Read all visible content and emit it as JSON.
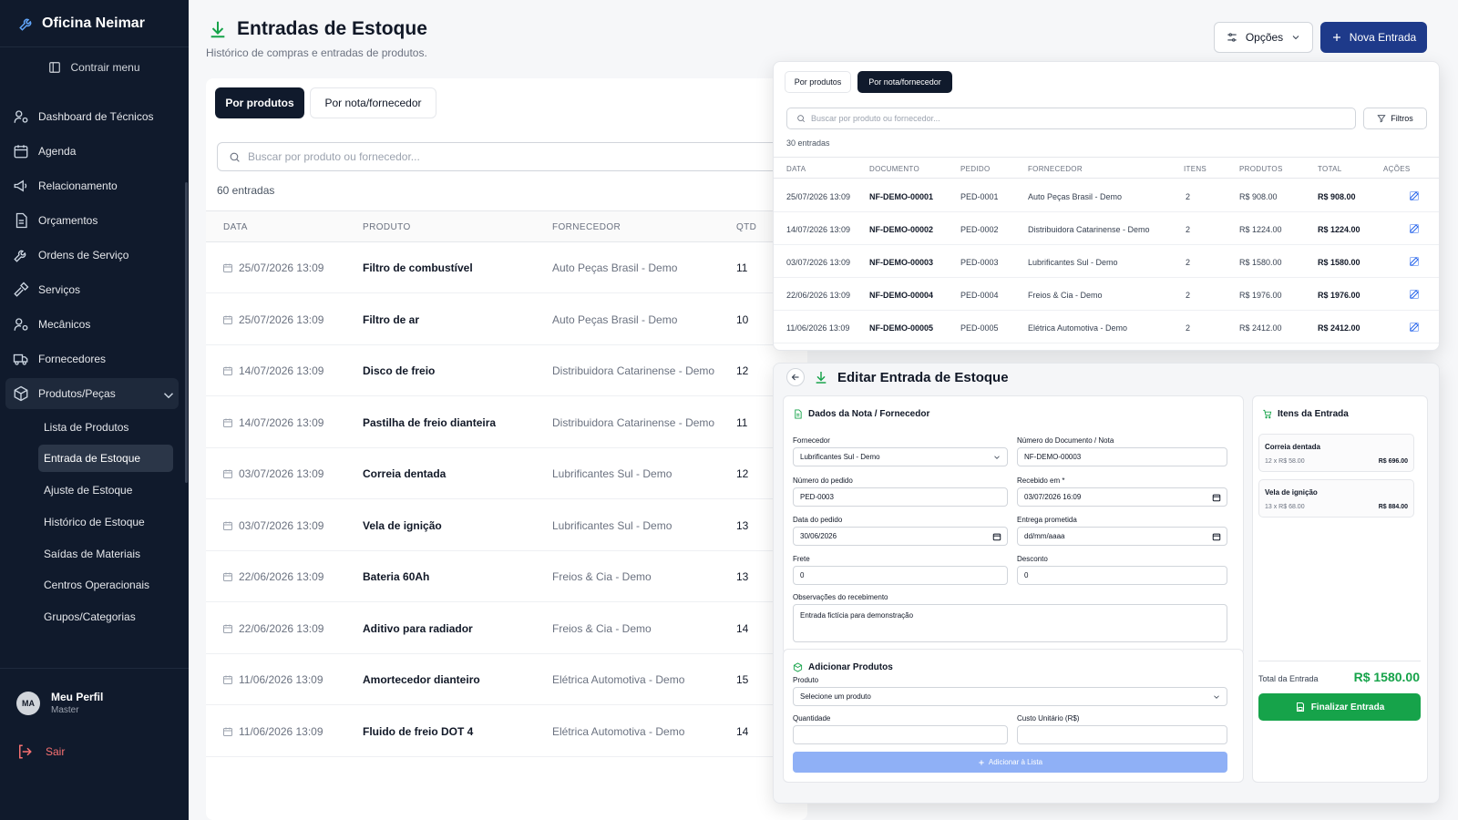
{
  "sidebar": {
    "brand": "Oficina Neimar",
    "collapse_label": "Contrair menu",
    "items": [
      {
        "label": "Dashboard de Técnicos",
        "icon": "users-gear-icon"
      },
      {
        "label": "Agenda",
        "icon": "calendar-icon"
      },
      {
        "label": "Relacionamento",
        "icon": "megaphone-icon"
      },
      {
        "label": "Orçamentos",
        "icon": "document-icon"
      },
      {
        "label": "Ordens de Serviço",
        "icon": "wrench-icon"
      },
      {
        "label": "Serviços",
        "icon": "hammer-icon"
      },
      {
        "label": "Mecânicos",
        "icon": "user-gear-icon"
      },
      {
        "label": "Fornecedores",
        "icon": "truck-icon"
      },
      {
        "label": "Produtos/Peças",
        "icon": "box-icon"
      }
    ],
    "subitems": [
      "Lista de Produtos",
      "Entrada de Estoque",
      "Ajuste de Estoque",
      "Histórico de Estoque",
      "Saídas de Materiais",
      "Centros Operacionais",
      "Grupos/Categorias"
    ],
    "profile": {
      "initials": "MA",
      "name": "Meu Perfil",
      "role": "Master"
    },
    "logout": "Sair"
  },
  "header": {
    "title": "Entradas de Estoque",
    "subtitle": "Histórico de compras e entradas de produtos.",
    "options_label": "Opções",
    "new_label": "Nova Entrada"
  },
  "main": {
    "tabs": [
      "Por produtos",
      "Por nota/fornecedor"
    ],
    "search_placeholder": "Buscar por produto ou fornecedor...",
    "count": "60 entradas",
    "columns": [
      "DATA",
      "PRODUTO",
      "FORNECEDOR",
      "QTD"
    ],
    "rows": [
      {
        "date": "25/07/2026 13:09",
        "product": "Filtro de combustível",
        "supplier": "Auto Peças Brasil - Demo",
        "qty": "11"
      },
      {
        "date": "25/07/2026 13:09",
        "product": "Filtro de ar",
        "supplier": "Auto Peças Brasil - Demo",
        "qty": "10"
      },
      {
        "date": "14/07/2026 13:09",
        "product": "Disco de freio",
        "supplier": "Distribuidora Catarinense - Demo",
        "qty": "12"
      },
      {
        "date": "14/07/2026 13:09",
        "product": "Pastilha de freio dianteira",
        "supplier": "Distribuidora Catarinense - Demo",
        "qty": "11"
      },
      {
        "date": "03/07/2026 13:09",
        "product": "Correia dentada",
        "supplier": "Lubrificantes Sul - Demo",
        "qty": "12"
      },
      {
        "date": "03/07/2026 13:09",
        "product": "Vela de ignição",
        "supplier": "Lubrificantes Sul - Demo",
        "qty": "13"
      },
      {
        "date": "22/06/2026 13:09",
        "product": "Bateria 60Ah",
        "supplier": "Freios & Cia - Demo",
        "qty": "13"
      },
      {
        "date": "22/06/2026 13:09",
        "product": "Aditivo para radiador",
        "supplier": "Freios & Cia - Demo",
        "qty": "14"
      },
      {
        "date": "11/06/2026 13:09",
        "product": "Amortecedor dianteiro",
        "supplier": "Elétrica Automotiva - Demo",
        "qty": "15"
      },
      {
        "date": "11/06/2026 13:09",
        "product": "Fluido de freio DOT 4",
        "supplier": "Elétrica Automotiva - Demo",
        "qty": "14"
      }
    ]
  },
  "notes_view": {
    "tabs": [
      "Por produtos",
      "Por nota/fornecedor"
    ],
    "search_placeholder": "Buscar por produto ou fornecedor...",
    "filter_label": "Filtros",
    "count": "30 entradas",
    "columns": [
      "DATA",
      "DOCUMENTO",
      "PEDIDO",
      "FORNECEDOR",
      "ITENS",
      "PRODUTOS",
      "TOTAL",
      "AÇÕES"
    ],
    "rows": [
      {
        "date": "25/07/2026 13:09",
        "doc": "NF-DEMO-00001",
        "order": "PED-0001",
        "supplier": "Auto Peças Brasil - Demo",
        "items": "2",
        "products": "R$ 908.00",
        "total": "R$ 908.00"
      },
      {
        "date": "14/07/2026 13:09",
        "doc": "NF-DEMO-00002",
        "order": "PED-0002",
        "supplier": "Distribuidora Catarinense - Demo",
        "items": "2",
        "products": "R$ 1224.00",
        "total": "R$ 1224.00"
      },
      {
        "date": "03/07/2026 13:09",
        "doc": "NF-DEMO-00003",
        "order": "PED-0003",
        "supplier": "Lubrificantes Sul - Demo",
        "items": "2",
        "products": "R$ 1580.00",
        "total": "R$ 1580.00"
      },
      {
        "date": "22/06/2026 13:09",
        "doc": "NF-DEMO-00004",
        "order": "PED-0004",
        "supplier": "Freios & Cia - Demo",
        "items": "2",
        "products": "R$ 1976.00",
        "total": "R$ 1976.00"
      },
      {
        "date": "11/06/2026 13:09",
        "doc": "NF-DEMO-00005",
        "order": "PED-0005",
        "supplier": "Elétrica Automotiva - Demo",
        "items": "2",
        "products": "R$ 2412.00",
        "total": "R$ 2412.00"
      }
    ]
  },
  "edit": {
    "title": "Editar Entrada de Estoque",
    "section_title": "Dados da Nota / Fornecedor",
    "supplier_label": "Fornecedor",
    "supplier_value": "Lubrificantes Sul - Demo",
    "doc_label": "Número do Documento / Nota",
    "doc_value": "NF-DEMO-00003",
    "order_label": "Número do pedido",
    "order_value": "PED-0003",
    "received_label": "Recebido em *",
    "received_value": "03/07/2026 16:09",
    "order_date_label": "Data do pedido",
    "order_date_value": "30/06/2026",
    "promised_label": "Entrega prometida",
    "promised_value": "dd/mm/aaaa",
    "freight_label": "Frete",
    "freight_value": "0",
    "discount_label": "Desconto",
    "discount_value": "0",
    "notes_label": "Observações do recebimento",
    "notes_value": "Entrada fictícia para demonstração",
    "add_title": "Adicionar Produtos",
    "product_label": "Produto",
    "product_placeholder": "Selecione um produto",
    "qty_label": "Quantidade",
    "unit_cost_label": "Custo Unitário (R$)",
    "add_button": "Adicionar à Lista",
    "items_title": "Itens da Entrada",
    "items": [
      {
        "name": "Correia dentada",
        "qty": "12 x R$ 58.00",
        "total": "R$ 696.00"
      },
      {
        "name": "Vela de ignição",
        "qty": "13 x R$ 68.00",
        "total": "R$ 884.00"
      }
    ],
    "total_label": "Total da Entrada",
    "total_value": "R$ 1580.00",
    "finish_button": "Finalizar Entrada"
  },
  "colors": {
    "sidebar": "#101a2c",
    "primary": "#1e3a8a",
    "success": "#16a34a",
    "accent": "#2563eb"
  }
}
